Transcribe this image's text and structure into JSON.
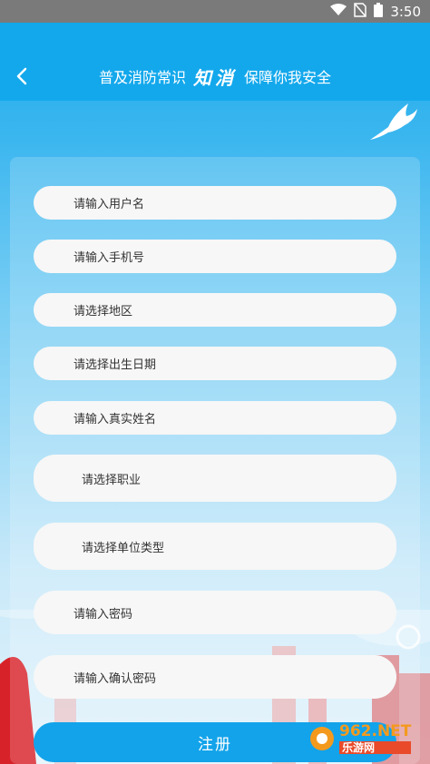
{
  "status_bar": {
    "time": "3:50"
  },
  "header": {
    "title_left": "普及消防常识",
    "title_logo": "知消",
    "title_right": "保障你我安全"
  },
  "form": {
    "fields": [
      "请输入用户名",
      "请输入手机号",
      "请选择地区",
      "请选择出生日期",
      "请输入真实姓名",
      "请选择职业",
      "请选择单位类型",
      "请输入密码",
      "请输入确认密码"
    ],
    "register_label": "注册"
  },
  "watermark": {
    "line1": "962.NET",
    "line2": "乐游网"
  },
  "colors": {
    "primary": "#13a8ec",
    "field_bg": "#f7f7f7"
  }
}
